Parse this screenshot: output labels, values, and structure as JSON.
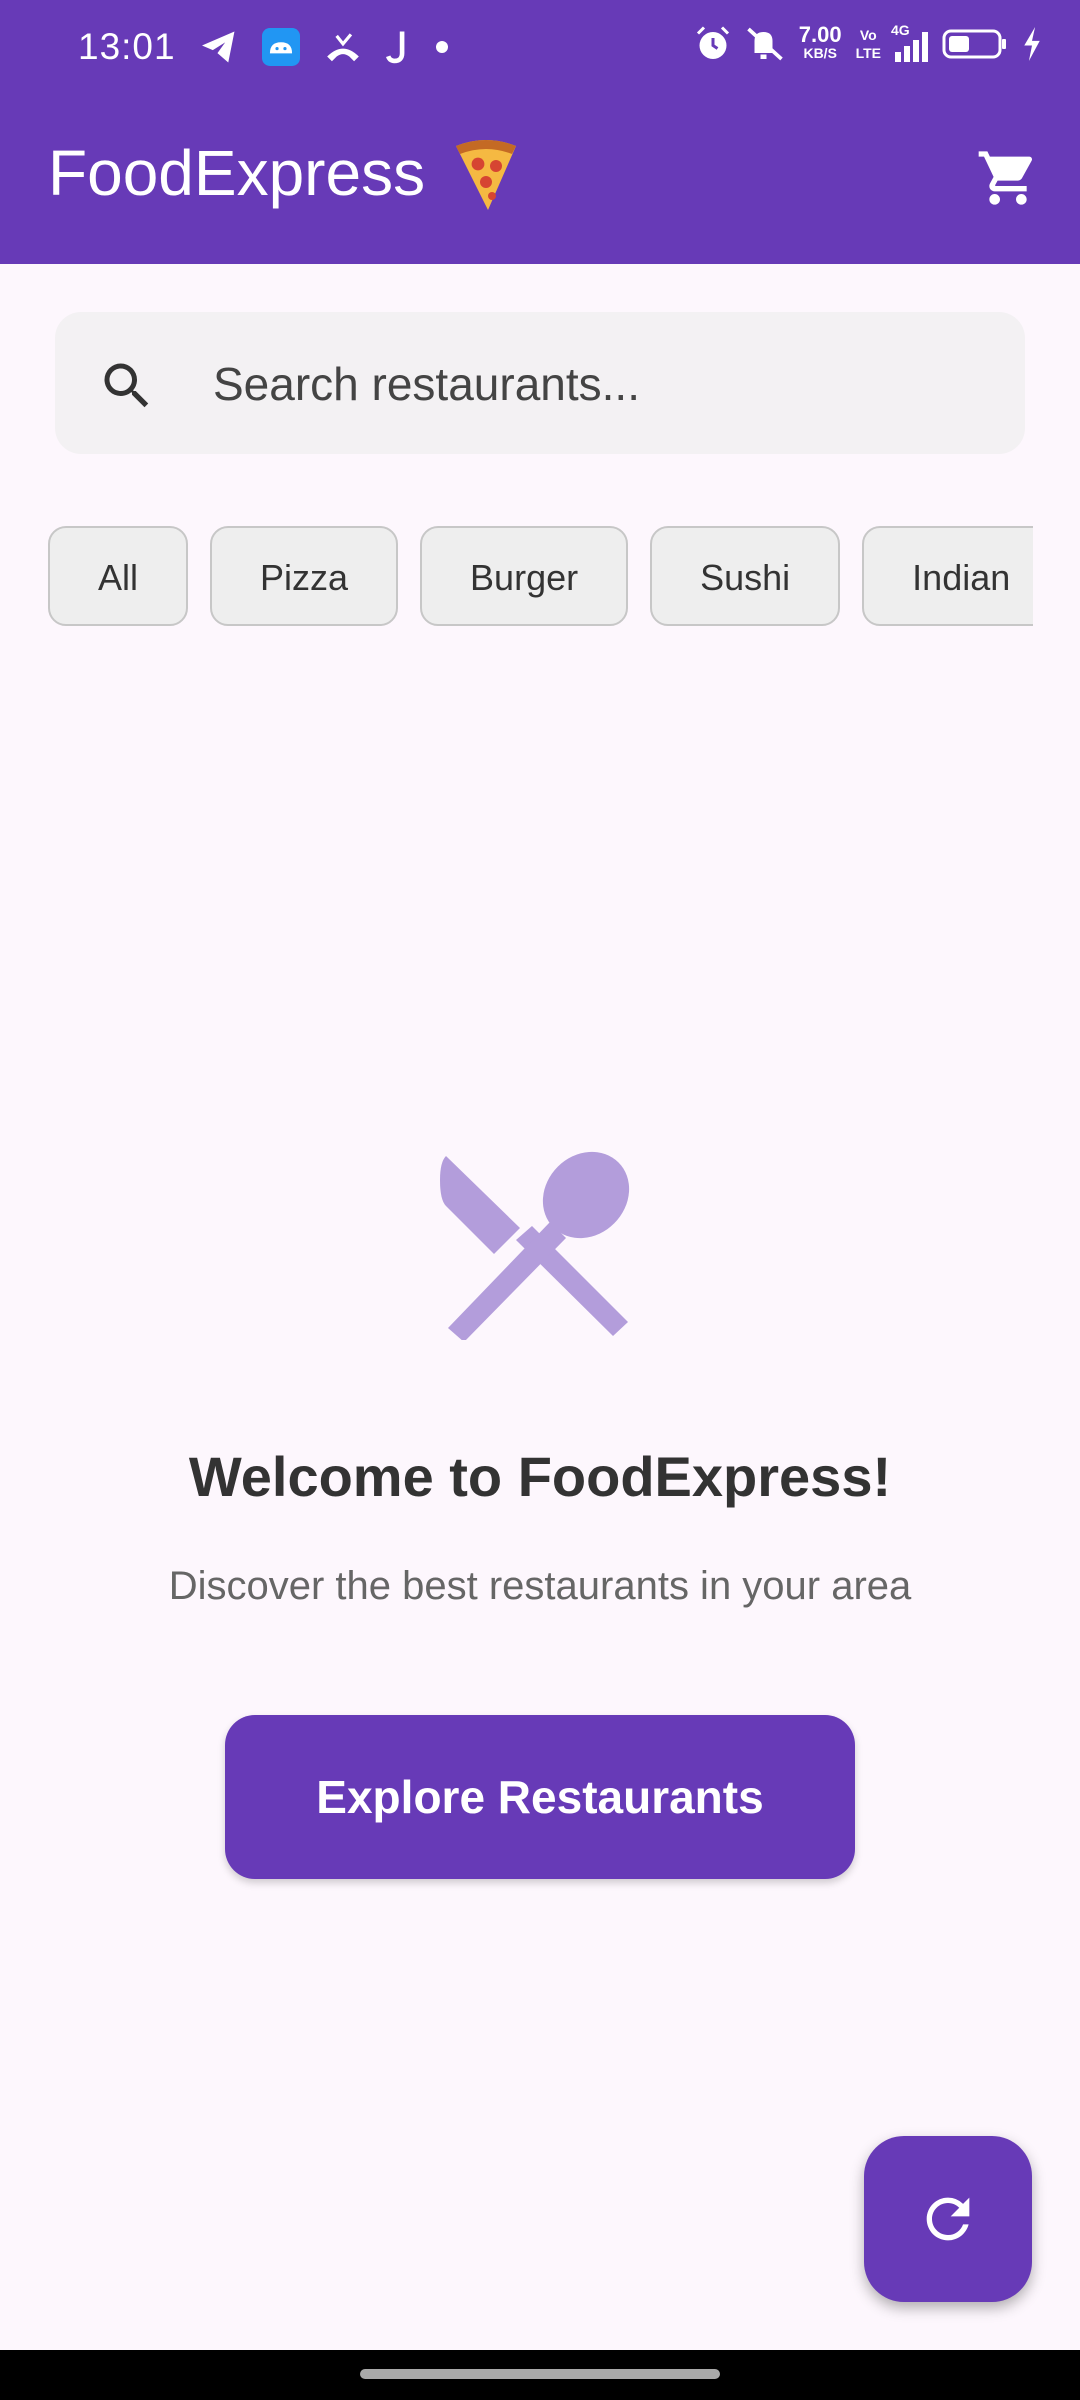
{
  "status_bar": {
    "time": "13:01",
    "network_speed_value": "7.00",
    "network_speed_unit": "KB/S",
    "volte_line1": "Vo",
    "volte_line2": "LTE",
    "network_type": "4G",
    "icons": [
      "telegram-icon",
      "android-icon",
      "missed-call-icon",
      "j-app-icon",
      "notification-dot-icon",
      "alarm-icon",
      "mute-icon",
      "signal-icon",
      "battery-icon",
      "charging-icon"
    ]
  },
  "app_bar": {
    "title": "FoodExpress",
    "title_emoji": "pizza-icon",
    "action_icon": "shopping-cart-icon"
  },
  "search": {
    "placeholder": "Search restaurants...",
    "value": ""
  },
  "categories": [
    "All",
    "Pizza",
    "Burger",
    "Sushi",
    "Indian"
  ],
  "empty_state": {
    "icon": "restaurant-utensils-icon",
    "heading": "Welcome to FoodExpress!",
    "subheading": "Discover the best restaurants in your area",
    "button_label": "Explore Restaurants"
  },
  "fab": {
    "icon": "refresh-icon"
  },
  "colors": {
    "primary": "#673AB7",
    "icon_tint": "#B39DDB",
    "background": "#FDF7FD",
    "chip_background": "#EEEEEE"
  }
}
